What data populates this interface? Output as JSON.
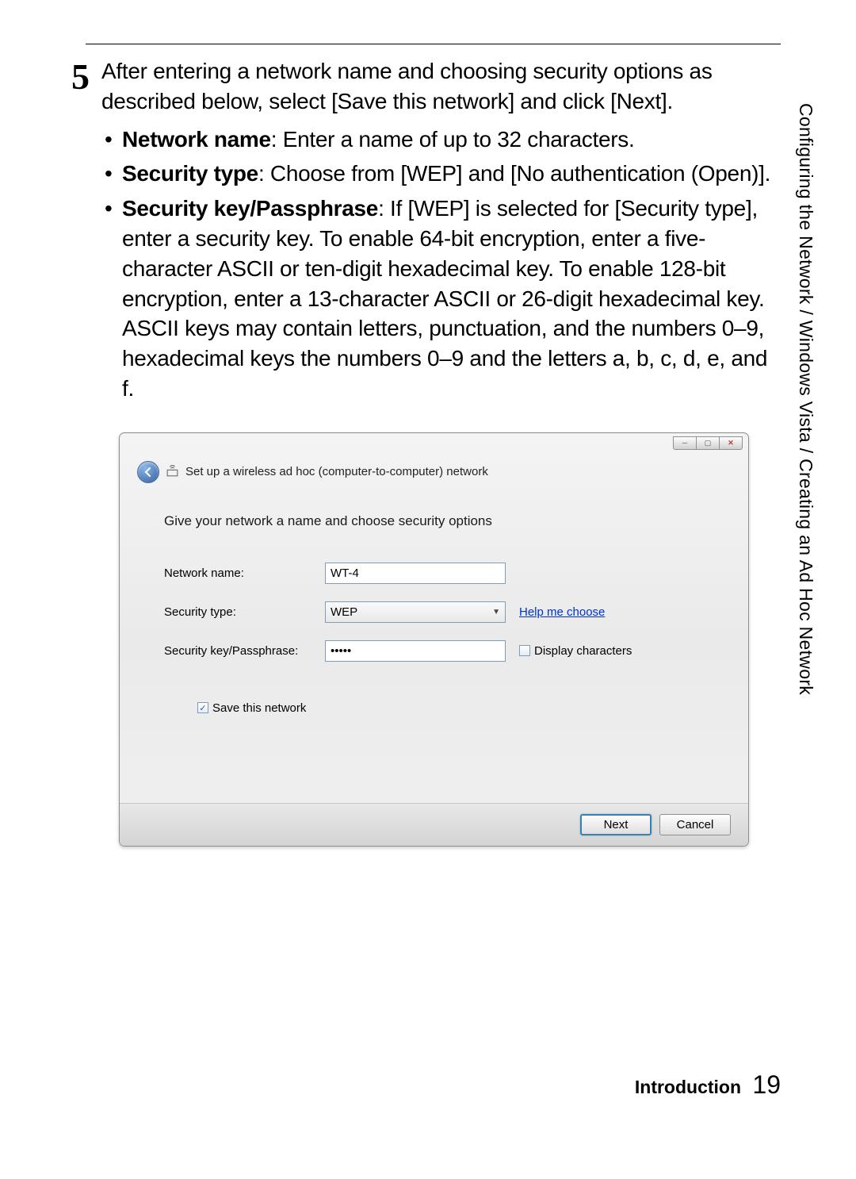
{
  "step": {
    "number": "5",
    "intro": "After entering a network name and choosing security options as described below, select [Save this network] and click [Next].",
    "bullets": [
      {
        "label": "Network name",
        "text": ": Enter a name of up to 32 characters."
      },
      {
        "label": "Security type",
        "text": ": Choose from [WEP] and [No authentication (Open)]."
      },
      {
        "label": "Security key/Passphrase",
        "text": ": If [WEP] is selected for [Security type], enter a security key.  To enable 64-bit encryption, enter a five-character ASCII or ten-digit hexadecimal key.  To enable 128-bit encryption, enter a 13-character ASCII or 26-digit hexadecimal key.  ASCII keys may contain letters, punctuation, and the numbers 0–9, hexadecimal keys the numbers 0–9 and the letters a, b, c, d, e, and f."
      }
    ]
  },
  "sideHeader": "Configuring the Network / Windows Vista / Creating an Ad Hoc Network",
  "dialog": {
    "title": "Set up a wireless ad hoc (computer-to-computer) network",
    "heading": "Give your network a name and choose security options",
    "fields": {
      "networkNameLabel": "Network name:",
      "networkNameValue": "WT-4",
      "securityTypeLabel": "Security type:",
      "securityTypeValue": "WEP",
      "helpLink": "Help me choose",
      "passphraseLabel": "Security key/Passphrase:",
      "passphraseValue": "•••••",
      "displayCharsLabel": "Display characters",
      "displayCharsChecked": false,
      "saveNetworkLabel": "Save this network",
      "saveNetworkChecked": true
    },
    "buttons": {
      "next": "Next",
      "cancel": "Cancel"
    }
  },
  "footer": {
    "section": "Introduction",
    "page": "19"
  }
}
